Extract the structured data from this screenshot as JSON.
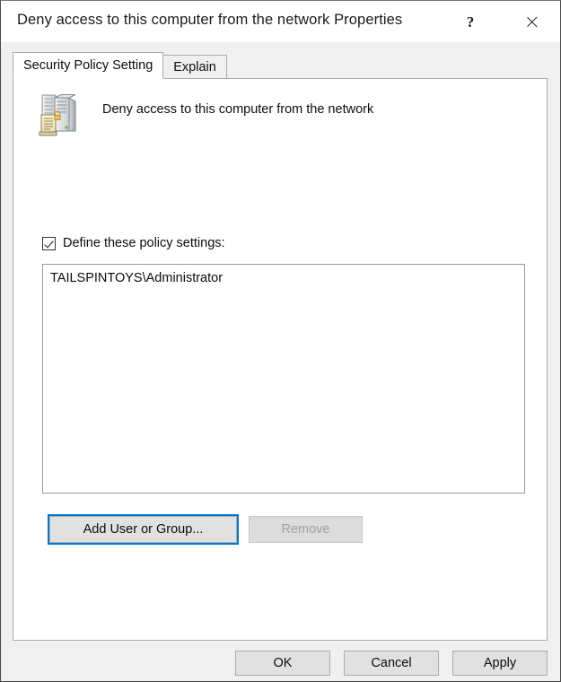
{
  "window": {
    "title": "Deny access to this computer from the network Properties",
    "help_button": "?",
    "close_button": "✕"
  },
  "tabs": [
    {
      "label": "Security Policy Setting",
      "active": true
    },
    {
      "label": "Explain",
      "active": false
    }
  ],
  "policy": {
    "icon": "server-policy-icon",
    "name": "Deny access to this computer from the network"
  },
  "define_checkbox": {
    "label": "Define these policy settings:",
    "checked": true
  },
  "list": {
    "items": [
      {
        "label": "TAILSPINTOYS\\Administrator"
      }
    ]
  },
  "buttons": {
    "add_user_or_group": "Add User or Group...",
    "remove": "Remove",
    "ok": "OK",
    "cancel": "Cancel",
    "apply": "Apply"
  },
  "colors": {
    "focus_outline": "#0078d7",
    "dialog_background": "#f0f0f0",
    "panel_background": "#ffffff",
    "button_face": "#e1e1e1",
    "disabled_text": "#a2a2a2",
    "text": "#0d0d0d"
  }
}
